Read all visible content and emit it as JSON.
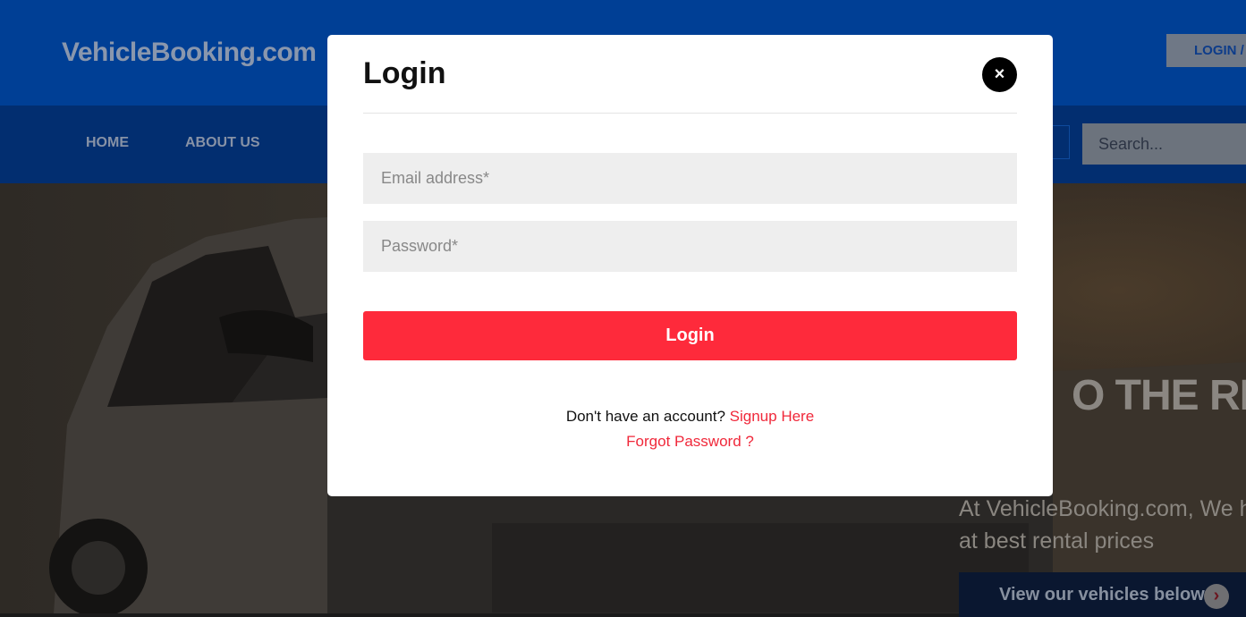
{
  "header": {
    "brand": "VehicleBooking.com",
    "login_button": "LOGIN /"
  },
  "nav": {
    "items": [
      {
        "label": "HOME"
      },
      {
        "label": "ABOUT US"
      }
    ],
    "search_placeholder": "Search..."
  },
  "hero": {
    "heading": "O THE RIG",
    "text_line1": "At VehicleBooking.com, We h",
    "text_line2": "at best rental prices",
    "cta_label": "View our vehicles below",
    "cta_icon": "›"
  },
  "modal": {
    "title": "Login",
    "close_icon": "×",
    "email_placeholder": "Email address*",
    "password_placeholder": "Password*",
    "login_button": "Login",
    "no_account_text": "Don't have an account?",
    "signup_link": "Signup Here",
    "forgot_link": "Forgot Password ?"
  },
  "colors": {
    "header_bg": "#003f95",
    "nav_bg": "#022e70",
    "accent": "#fe2a3b",
    "modal_bg": "#ffffff"
  }
}
